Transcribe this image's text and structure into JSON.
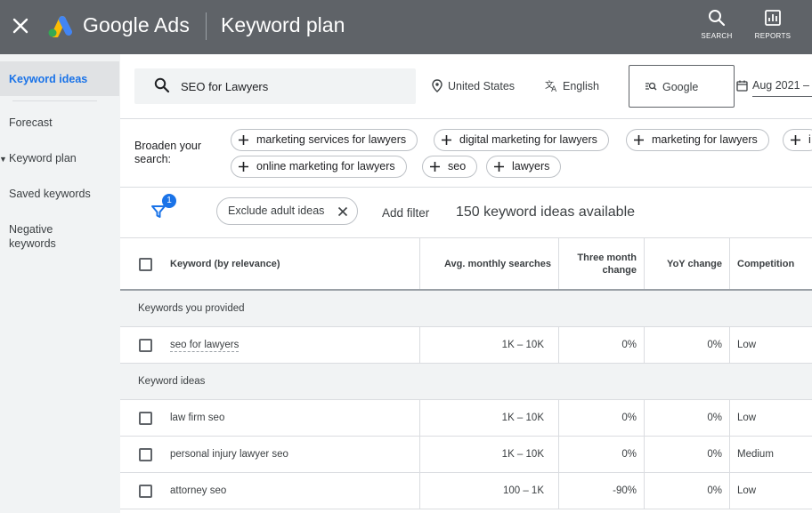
{
  "header": {
    "brand": "Google Ads",
    "page_title": "Keyword plan",
    "search_label": "SEARCH",
    "reports_label": "REPORTS"
  },
  "sidebar": {
    "items": [
      {
        "label": "Keyword ideas"
      },
      {
        "label": "Forecast"
      },
      {
        "label": "Keyword plan"
      },
      {
        "label": "Saved keywords"
      },
      {
        "label": "Negative keywords"
      }
    ]
  },
  "search": {
    "query": "SEO for Lawyers",
    "location": "United States",
    "language": "English",
    "network": "Google",
    "date_range": "Aug 2021 –"
  },
  "broaden": {
    "label": "Broaden your search:",
    "chips": [
      "marketing services for lawyers",
      "digital marketing for lawyers",
      "marketing for lawyers",
      "i",
      "online marketing for lawyers",
      "seo",
      "lawyers"
    ]
  },
  "filters": {
    "badge_count": "1",
    "active_filter": "Exclude adult ideas",
    "add_filter": "Add filter",
    "ideas_count": "150 keyword ideas available"
  },
  "table": {
    "headers": {
      "keyword": "Keyword (by relevance)",
      "avg": "Avg. monthly searches",
      "three_month_1": "Three month",
      "three_month_2": "change",
      "yoy": "YoY change",
      "competition": "Competition"
    },
    "section_provided": "Keywords you provided",
    "section_ideas": "Keyword ideas",
    "provided_rows": [
      {
        "keyword": "seo for lawyers",
        "avg": "1K – 10K",
        "three_month": "0%",
        "yoy": "0%",
        "competition": "Low"
      }
    ],
    "idea_rows": [
      {
        "keyword": "law firm seo",
        "avg": "1K – 10K",
        "three_month": "0%",
        "yoy": "0%",
        "competition": "Low"
      },
      {
        "keyword": "personal injury lawyer seo",
        "avg": "1K – 10K",
        "three_month": "0%",
        "yoy": "0%",
        "competition": "Medium"
      },
      {
        "keyword": "attorney seo",
        "avg": "100 – 1K",
        "three_month": "-90%",
        "yoy": "0%",
        "competition": "Low"
      }
    ]
  },
  "colors": {
    "topbar": "#5f6368",
    "accent": "#1a73e8",
    "sidebar": "#f1f3f4"
  }
}
